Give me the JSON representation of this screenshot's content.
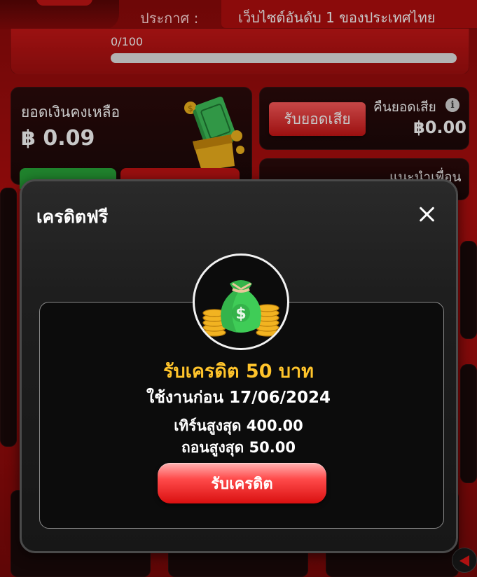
{
  "header": {
    "announce_label": "ประกาศ :",
    "announce_text": "เว็บไซต์อันดับ 1 ของประเทศไทย"
  },
  "progress": {
    "text": "0/100",
    "fraction": 0
  },
  "wallet": {
    "label": "ยอดเงินคงเหลือ",
    "amount": "฿ 0.09"
  },
  "cashback": {
    "button_label": "รับยอดเสีย",
    "label": "คืนยอดเสีย",
    "info_icon": "i",
    "amount": "฿0.00"
  },
  "referral": {
    "label": "แนะนำเพื่อน"
  },
  "modal": {
    "title": "เครดิตฟรี",
    "credit_title": "รับเครดิต 50 บาท",
    "use_before": "ใช้งานก่อน 17/06/2024",
    "turnover": "เทิร์นสูงสุด 400.00",
    "withdraw": "ถอนสูงสุด 50.00",
    "claim_button": "รับเครดิต",
    "close_icon": "close-icon",
    "badge_icon": "money-bag-icon"
  },
  "colors": {
    "accent_gold": "#ffc42b",
    "brand_red": "#b30f0f",
    "button_red": "#d91010",
    "progress_green": "#35c24a"
  }
}
